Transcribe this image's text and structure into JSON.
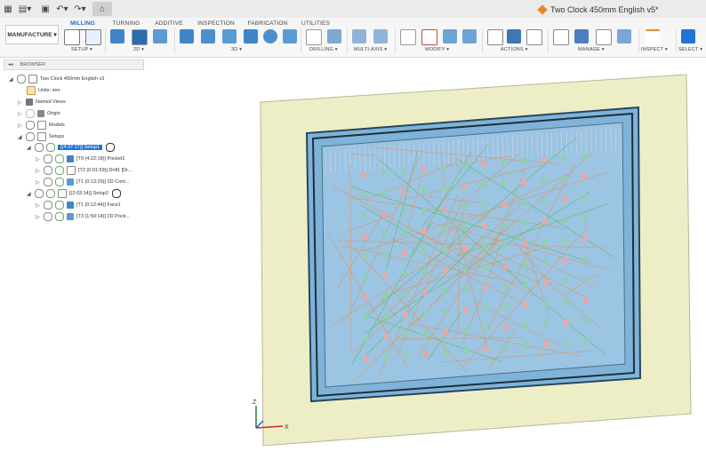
{
  "document": {
    "title": "Two Clock 450mm English v5*"
  },
  "tabs": [
    "MILLING",
    "TURNING",
    "ADDITIVE",
    "INSPECTION",
    "FABRICATION",
    "UTILITIES"
  ],
  "workspace": "MANUFACTURE",
  "groups": [
    "SETUP",
    "2D",
    "3D",
    "DRILLING",
    "MULTI-AXIS",
    "MODIFY",
    "ACTIONS",
    "MANAGE",
    "INSPECT",
    "SELECT"
  ],
  "browser": {
    "header": "BROWSER",
    "root": "Two Clock 450mm English v3",
    "units": "Units: mm",
    "named_views": "Named Views",
    "origin": "Origin",
    "models": "Models",
    "setups": "Setups",
    "setup1": "[(4:37:17)] Setup1",
    "op1": "[T9 (4:22:18)] Pocket1",
    "op2": "[T2 (0:01:59)] Drill1 [Dr...",
    "op3": "[T1 (0:12:29)] 2D Cont...",
    "setup2": "[(2:03:14)] Setup2",
    "op4": "[T1 (0:12:44)] Face1",
    "op5": "[T3 (1:50:14)] 2D Pock..."
  },
  "axis": {
    "z": "Z",
    "x": "X"
  },
  "colors": {
    "accent": "#1c6bd1",
    "stock": "#eeeec6",
    "part": "#7fb3d9",
    "toolpath": "#d89a6a"
  }
}
